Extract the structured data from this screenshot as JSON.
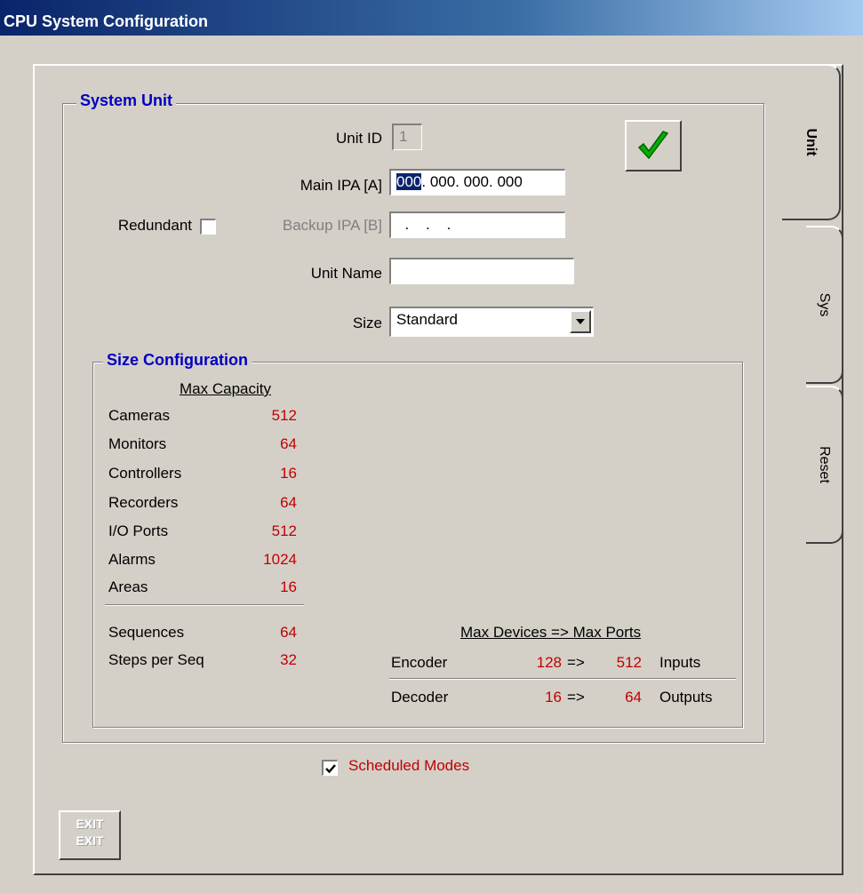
{
  "window": {
    "title": "CPU System Configuration"
  },
  "tabs": [
    {
      "label": "Unit",
      "active": true
    },
    {
      "label": "Sys",
      "active": false
    },
    {
      "label": "Reset",
      "active": false
    }
  ],
  "system_unit": {
    "legend": "System Unit",
    "unit_id_label": "Unit ID",
    "unit_id_value": "1",
    "main_ipa_label": "Main IPA [A]",
    "main_ipa_selected": "000",
    "main_ipa_rest": ". 000. 000. 000",
    "redundant_label": "Redundant",
    "redundant_checked": false,
    "backup_ipa_label": "Backup IPA [B]",
    "backup_ipa_value": "  .    .    .",
    "unit_name_label": "Unit Name",
    "unit_name_value": "",
    "size_label": "Size",
    "size_value": "Standard",
    "apply_icon": "checkmark-icon"
  },
  "size_configuration": {
    "legend": "Size Configuration",
    "max_capacity_header": "Max Capacity",
    "capacities": [
      {
        "label": "Cameras",
        "value": "512"
      },
      {
        "label": "Monitors",
        "value": "64"
      },
      {
        "label": "Controllers",
        "value": "16"
      },
      {
        "label": "Recorders",
        "value": "64"
      },
      {
        "label": "I/O Ports",
        "value": "512"
      },
      {
        "label": "Alarms",
        "value": "1024"
      },
      {
        "label": "Areas",
        "value": "16"
      }
    ],
    "sequences": [
      {
        "label": "Sequences",
        "value": "64"
      },
      {
        "label": "Steps per Seq",
        "value": "32"
      }
    ],
    "devices_header": "Max Devices => Max Ports",
    "devices": [
      {
        "label": "Encoder",
        "devices": "128",
        "arrow": "=>",
        "ports": "512",
        "port_type": "Inputs"
      },
      {
        "label": "Decoder",
        "devices": "16",
        "arrow": "=>",
        "ports": "64",
        "port_type": "Outputs"
      }
    ]
  },
  "scheduled_modes": {
    "label": "Scheduled Modes",
    "checked": true
  },
  "exit_button": {
    "label_line1": "EXIT",
    "label_line2": "EXIT"
  },
  "colors": {
    "accent_blue": "#0000c0",
    "value_red": "#c00000",
    "check_green": "#00a000"
  }
}
